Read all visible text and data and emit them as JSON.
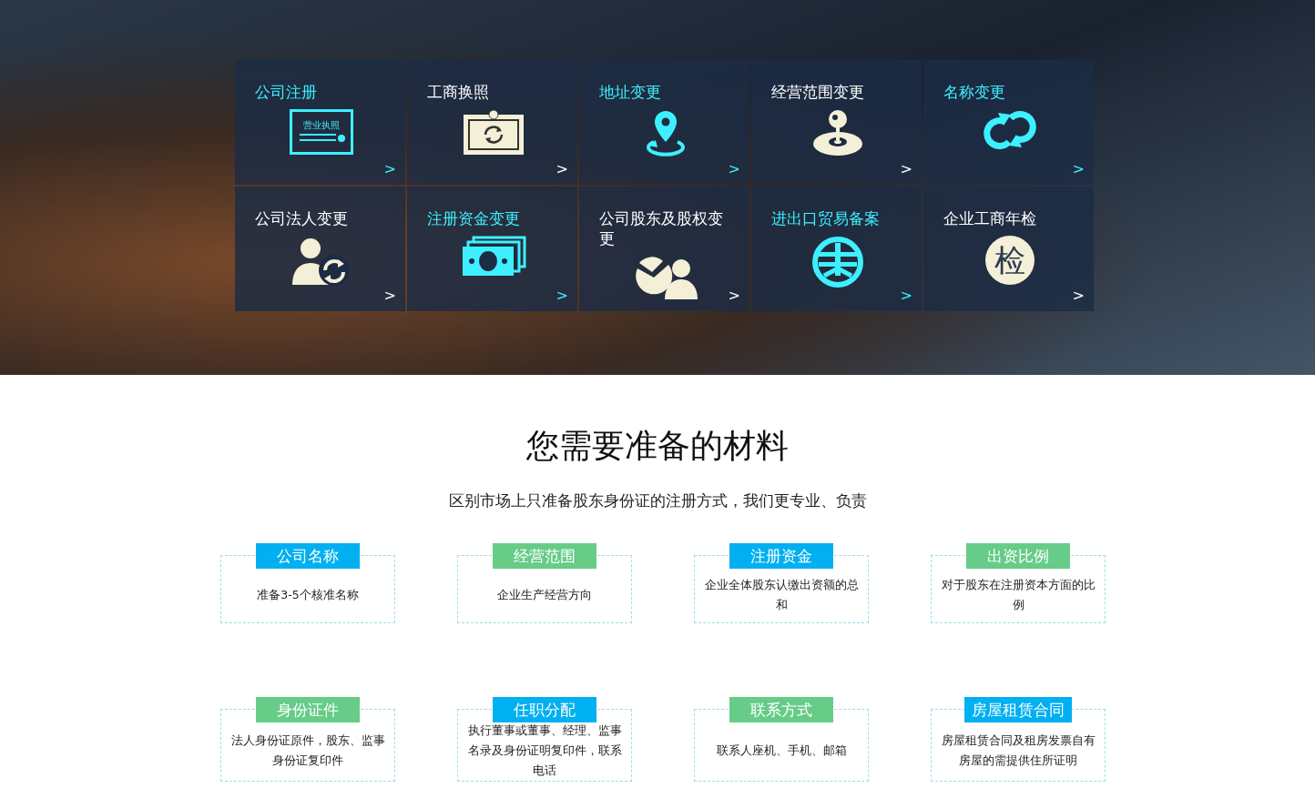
{
  "services": [
    {
      "title": "公司注册",
      "color": "#3ef0ff",
      "kind": "certificate"
    },
    {
      "title": "工商换照",
      "color": "#ffffff",
      "kind": "renew"
    },
    {
      "title": "地址变更",
      "color": "#3ef0ff",
      "kind": "pin"
    },
    {
      "title": "经营范围变更",
      "color": "#ffffff",
      "kind": "joystick"
    },
    {
      "title": "名称变更",
      "color": "#3ef0ff",
      "kind": "loop"
    },
    {
      "title": "公司法人变更",
      "color": "#ffffff",
      "kind": "person"
    },
    {
      "title": "注册资金变更",
      "color": "#3ef0ff",
      "kind": "money"
    },
    {
      "title": "公司股东及股权变更",
      "color": "#ffffff",
      "kind": "pie"
    },
    {
      "title": "进出口贸易备案",
      "color": "#3ef0ff",
      "kind": "seal"
    },
    {
      "title": "企业工商年检",
      "color": "#ffffff",
      "kind": "char",
      "glyph": "检"
    }
  ],
  "certificate_label": "营业执照",
  "arrow": ">",
  "materials": {
    "title": "您需要准备的材料",
    "subtitle": "区别市场上只准备股东身份证的注册方式，我们更专业、负责",
    "items": [
      {
        "tag": "公司名称",
        "color": "#00b0f0",
        "text": "准备3-5个核准名称"
      },
      {
        "tag": "经营范围",
        "color": "#66cc88",
        "text": "企业生产经营方向"
      },
      {
        "tag": "注册资金",
        "color": "#00b0f0",
        "text": "企业全体股东认缴出资额的总和"
      },
      {
        "tag": "出资比例",
        "color": "#66cc88",
        "text": "对于股东在注册资本方面的比例"
      },
      {
        "tag": "身份证件",
        "color": "#66cc88",
        "text": "法人身份证原件，股东、监事身份证复印件"
      },
      {
        "tag": "任职分配",
        "color": "#00b0f0",
        "text": "执行董事或董事、经理、监事名录及身份证明复印件，联系电话"
      },
      {
        "tag": "联系方式",
        "color": "#66cc88",
        "text": "联系人座机、手机、邮箱"
      },
      {
        "tag": "房屋租赁合同",
        "color": "#00b0f0",
        "text": "房屋租赁合同及租房发票自有房屋的需提供住所证明"
      }
    ]
  }
}
